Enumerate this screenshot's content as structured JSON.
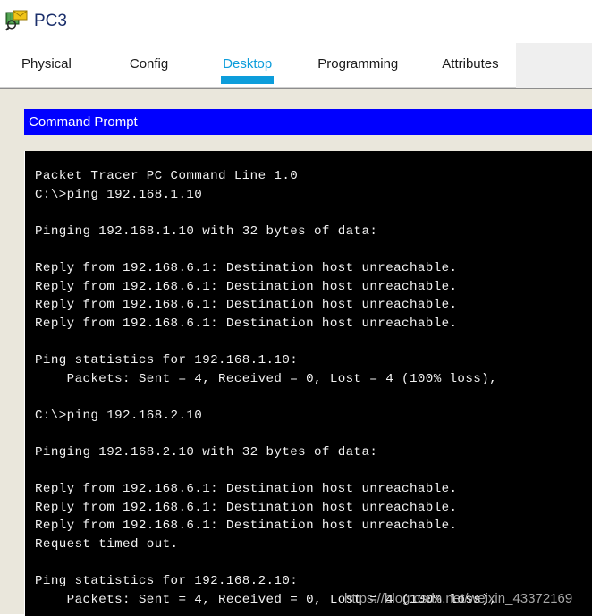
{
  "window": {
    "device_name": "PC3",
    "device_icon": "pc-inspect-icon"
  },
  "tabs": [
    {
      "label": "Physical",
      "active": false
    },
    {
      "label": "Config",
      "active": false
    },
    {
      "label": "Desktop",
      "active": true
    },
    {
      "label": "Programming",
      "active": false
    },
    {
      "label": "Attributes",
      "active": false
    }
  ],
  "colors": {
    "active_tab": "#0d9ddb",
    "panel_background": "#eae7dc",
    "app_titlebar": "#0000ff",
    "terminal_background": "#000000",
    "terminal_text": "#f2f2f2",
    "device_title": "#1b2f6b"
  },
  "app": {
    "title": "Command Prompt"
  },
  "terminal": {
    "lines": [
      "Packet Tracer PC Command Line 1.0",
      "C:\\>ping 192.168.1.10",
      "",
      "Pinging 192.168.1.10 with 32 bytes of data:",
      "",
      "Reply from 192.168.6.1: Destination host unreachable.",
      "Reply from 192.168.6.1: Destination host unreachable.",
      "Reply from 192.168.6.1: Destination host unreachable.",
      "Reply from 192.168.6.1: Destination host unreachable.",
      "",
      "Ping statistics for 192.168.1.10:",
      "    Packets: Sent = 4, Received = 0, Lost = 4 (100% loss),",
      "",
      "C:\\>ping 192.168.2.10",
      "",
      "Pinging 192.168.2.10 with 32 bytes of data:",
      "",
      "Reply from 192.168.6.1: Destination host unreachable.",
      "Reply from 192.168.6.1: Destination host unreachable.",
      "Reply from 192.168.6.1: Destination host unreachable.",
      "Request timed out.",
      "",
      "Ping statistics for 192.168.2.10:",
      "    Packets: Sent = 4, Received = 0, Lost = 4 (100% loss),"
    ],
    "text": "Packet Tracer PC Command Line 1.0\nC:\\>ping 192.168.1.10\n\nPinging 192.168.1.10 with 32 bytes of data:\n\nReply from 192.168.6.1: Destination host unreachable.\nReply from 192.168.6.1: Destination host unreachable.\nReply from 192.168.6.1: Destination host unreachable.\nReply from 192.168.6.1: Destination host unreachable.\n\nPing statistics for 192.168.1.10:\n    Packets: Sent = 4, Received = 0, Lost = 4 (100% loss),\n\nC:\\>ping 192.168.2.10\n\nPinging 192.168.2.10 with 32 bytes of data:\n\nReply from 192.168.6.1: Destination host unreachable.\nReply from 192.168.6.1: Destination host unreachable.\nReply from 192.168.6.1: Destination host unreachable.\nRequest timed out.\n\nPing statistics for 192.168.2.10:\n    Packets: Sent = 4, Received = 0, Lost = 4 (100% loss),"
  },
  "watermark": {
    "text": "https://blog.csdn.net/weixin_43372169"
  }
}
